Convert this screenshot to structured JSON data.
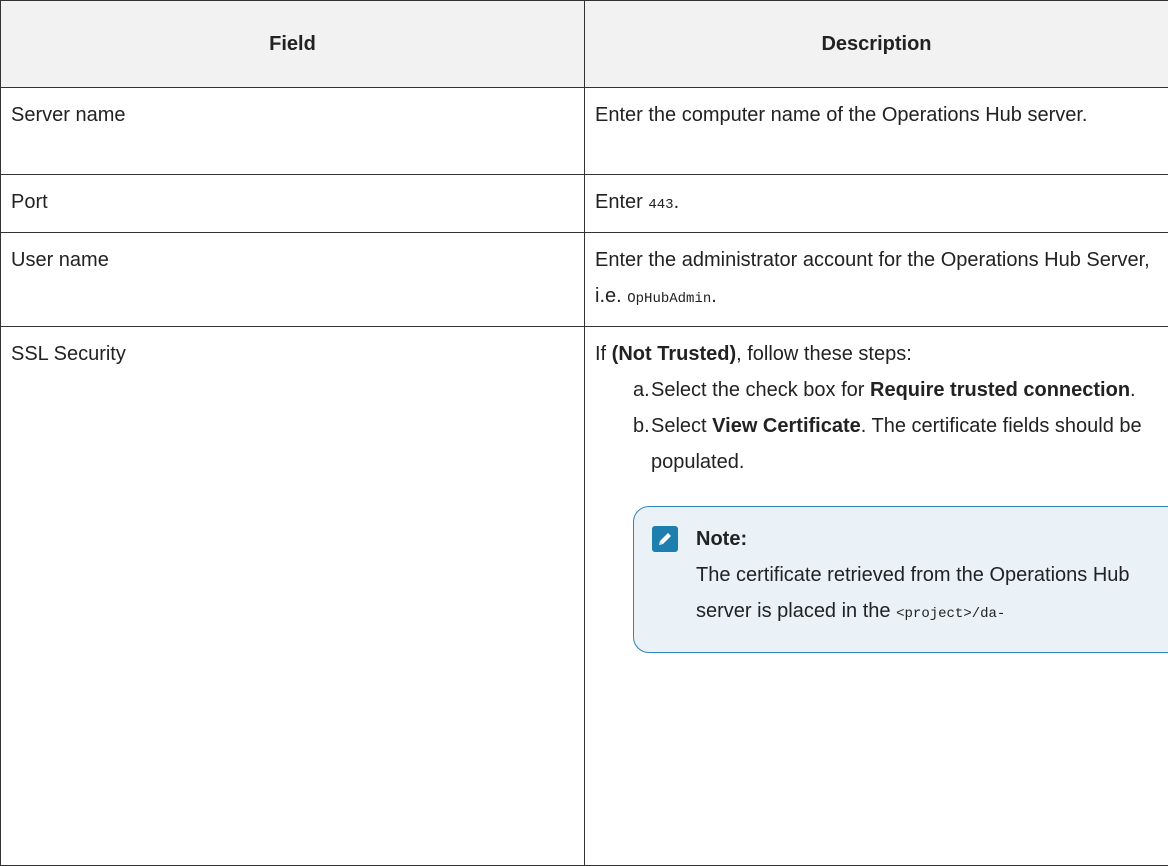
{
  "table": {
    "headers": {
      "field": "Field",
      "description": "Description"
    },
    "rows": {
      "server": {
        "field": "Server name",
        "description": "Enter the computer name of the Operations Hub server."
      },
      "port": {
        "field": "Port",
        "desc_prefix": "Enter ",
        "desc_code": "443",
        "desc_suffix": "."
      },
      "user": {
        "field": "User name",
        "desc_prefix": "Enter the administrator account for the Operations Hub Server, i.e. ",
        "desc_code": "OpHubAdmin",
        "desc_suffix": "."
      },
      "ssl": {
        "field": "SSL Security",
        "intro_prefix": "If ",
        "intro_bold": "(Not Trusted)",
        "intro_suffix": ", follow these steps:",
        "steps": [
          {
            "marker": "a.",
            "prefix": "Select the check box for ",
            "bold": "Require trusted connection",
            "suffix": "."
          },
          {
            "marker": "b.",
            "prefix": "Select ",
            "bold": "View Certificate",
            "suffix": ". The certificate fields should be populated."
          }
        ],
        "note": {
          "title": "Note:",
          "text": "The certificate retrieved from the Operations Hub server is placed in the ",
          "code": "<project>/da-",
          "icon": "pencil-icon",
          "accent_color": "#1c7fae",
          "background_color": "#eaf1f7"
        }
      }
    }
  }
}
